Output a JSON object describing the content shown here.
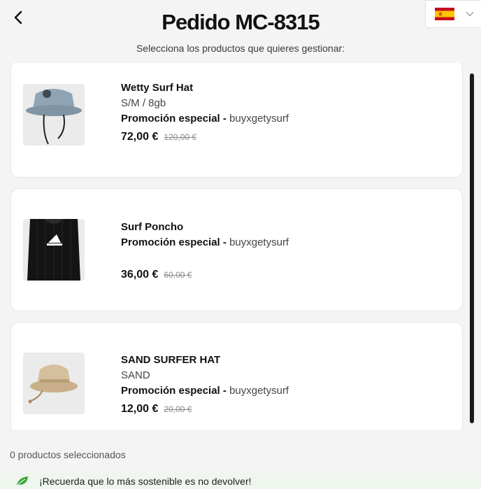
{
  "header": {
    "back_icon": "chevron-left-icon",
    "title": "Pedido MC-8315",
    "subtitle": "Selecciona los productos que quieres gestionar:",
    "language": {
      "flag": "spain-flag-icon",
      "dropdown_icon": "chevron-down-icon"
    }
  },
  "products": [
    {
      "name": "Wetty Surf Hat",
      "variant": "S/M / 8gb",
      "promo_label": "Promoción especial -",
      "promo_code": "buyxgetysurf",
      "price": "72,00 €",
      "old_price": "120,00 €"
    },
    {
      "name": "Surf Poncho",
      "promo_label": "Promoción especial -",
      "promo_code": "buyxgetysurf",
      "price": "36,00 €",
      "old_price": "60,00 €"
    },
    {
      "name": "SAND SURFER HAT",
      "variant": "SAND",
      "promo_label": "Promoción especial -",
      "promo_code": "buyxgetysurf",
      "price": "12,00 €",
      "old_price": "20,00 €"
    }
  ],
  "footer": {
    "selected_text": "0 productos seleccionados",
    "eco_icon": "leaf-icon",
    "eco_message": "¡Recuerda que lo más sostenible es no devolver!"
  },
  "colors": {
    "background": "#f4f4f5",
    "card": "#ffffff",
    "eco_banner": "#eef6ee",
    "leaf": "#3aa63a"
  }
}
